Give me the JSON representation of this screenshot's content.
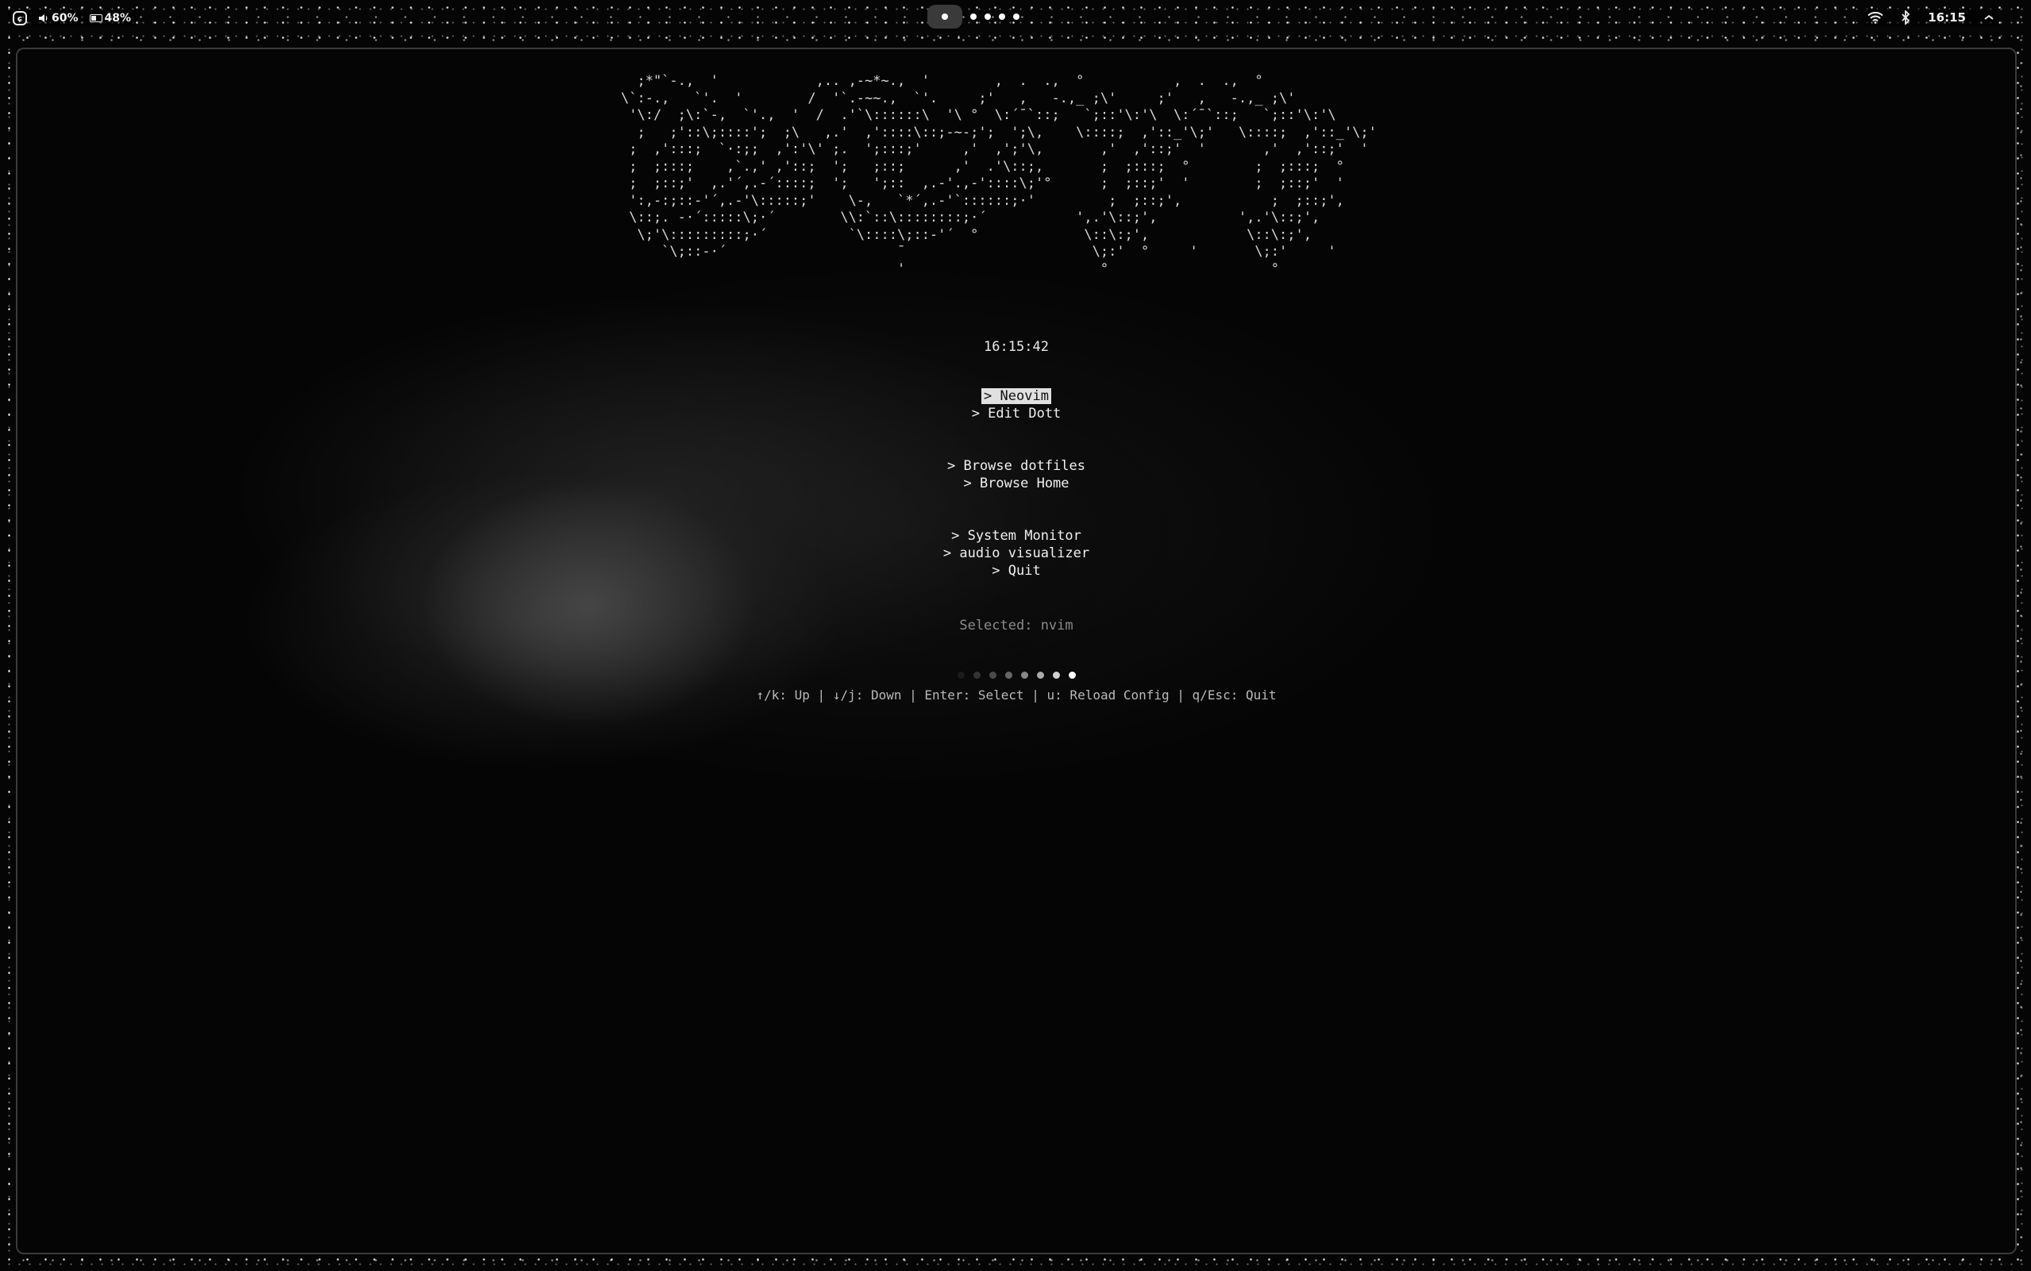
{
  "topbar": {
    "logo": "ɕ",
    "volume": "60%",
    "battery": "48%",
    "workspaces": {
      "active": 1,
      "count": 5
    },
    "clock": "16:15",
    "icons": [
      "speaker-icon",
      "battery-icon",
      "wifi-icon",
      "bluetooth-icon",
      "chevron-up-icon"
    ]
  },
  "launcher": {
    "ascii_logo": "  ;*\"`-.,  '            ,.. ,-~*~.,  '        ,  .  .,  °           ,  .  .,  °\n\\`:-.,   `'.  '        /  '`.-~~.,  `'.     ;'   ,   -.,_ ;\\'     ;'   ,   -.,_ ;\\'\n '\\:/  ;\\:`-,  `'.,  '  /  .'`\\::::::\\  '\\ °  \\:´¯`::;   `;::'\\:'\\  \\:´¯`::;   `;::'\\:'\\\n  ;   ;'::\\;::::';  ;\\   ,.'  ,'::::\\::;-~-;';  ';\\,    \\::::;  ,'::_'\\;'   \\::::;  ,'::_'\\;'\n ;  ,':::;  `·:;;  ,':'\\' ;.  ';:::;'     ,'  ,';'\\,       ,'  ,'::;'  '       ,'  ,'::;'  '\n ;  ;:::;    ,`.,' ,'::;  ';   ;::;      ,'  .'\\::;,       ;  ;:::;  °        ;  ;:::;  °\n ;  ;::;'  ,.'´,.-´::::;  ';   ';::  ,.-'.,-'::::\\;'°      ;  ;::;'  '        ;  ;::;'  '\n ':,-:;::-'´,.-'\\:::::;'    \\-,   `*´,.-'`::::::;·'         ;  ;::;',           ;  ;::;',\n \\::;. -·´:::::\\;·´        \\\\:`::\\::::::::;·´           ',.'\\::;',          ',.'\\::;',\n  \\;'\\:::::::::;·´          `\\::::\\;::-'´  °             \\::\\:;',            \\::\\:;',\n     `\\;::-·´                     ¯                       \\;:'  °     '       \\;:'     '\n                                  '                        °                    °",
    "time": "16:15:42",
    "menu": [
      {
        "label": "> Neovim",
        "selected": true
      },
      {
        "label": "> Edit Dott",
        "selected": false
      },
      {
        "label": "> Browse dotfiles",
        "selected": false
      },
      {
        "label": "> Browse Home",
        "selected": false
      },
      {
        "label": "> System Monitor",
        "selected": false
      },
      {
        "label": "> audio visualizer",
        "selected": false
      },
      {
        "label": "> Quit",
        "selected": false
      }
    ],
    "selected_text": "Selected: nvim",
    "progress_dots": [
      "#1c1c1c",
      "#333333",
      "#4a4a4a",
      "#666666",
      "#888888",
      "#aaaaaa",
      "#d0d0d0",
      "#ffffff"
    ],
    "help_text": "↑/k: Up | ↓/j: Down | Enter: Select | u: Reload Config | q/Esc: Quit"
  }
}
